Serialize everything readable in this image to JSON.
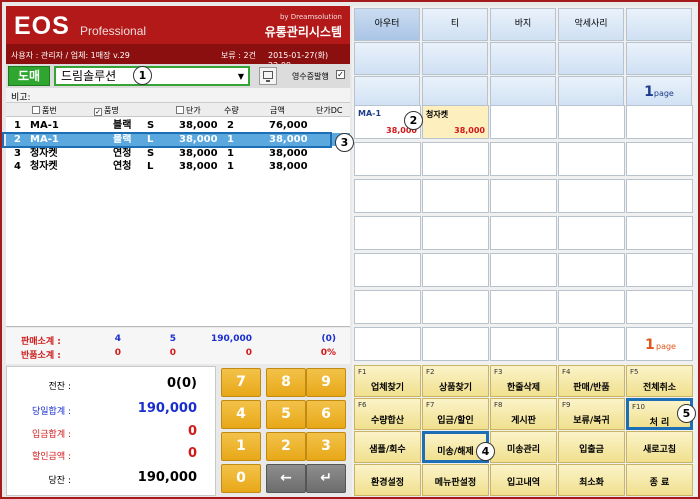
{
  "header": {
    "logo_main": "EOS",
    "logo_sub": "Professional",
    "by": "by Dreamsolution",
    "system_title": "유통관리시스템",
    "user_info": "사용자 : 관리자 / 업체: 1매장 v.29",
    "hold_label": "보류 :",
    "hold_count": "2건",
    "date": "2015-01-27(화) 22:09"
  },
  "customer": {
    "type_button": "도매",
    "selected": "드림솔루션",
    "receipt_label": "영수증발행",
    "receipt_checked": "✓",
    "note_label": "비고:"
  },
  "table": {
    "headers": [
      "품번",
      "품명",
      "단가",
      "수량",
      "금액",
      "단가DC"
    ],
    "header_checks": [
      "",
      "✓",
      ""
    ],
    "rows": [
      {
        "no": "1",
        "code": "MA-1",
        "color": "블랙",
        "size": "S",
        "price": "38,000",
        "qty": "2",
        "amount": "76,000"
      },
      {
        "no": "2",
        "code": "MA-1",
        "color": "블랙",
        "size": "L",
        "price": "38,000",
        "qty": "1",
        "amount": "38,000"
      },
      {
        "no": "3",
        "code": "청자켓",
        "color": "연청",
        "size": "S",
        "price": "38,000",
        "qty": "1",
        "amount": "38,000"
      },
      {
        "no": "4",
        "code": "청자켓",
        "color": "연청",
        "size": "L",
        "price": "38,000",
        "qty": "1",
        "amount": "38,000"
      }
    ]
  },
  "summary": {
    "sales": {
      "label": "판매소계 :",
      "a": "4",
      "b": "5",
      "amount": "190,000",
      "pct": "(0)"
    },
    "returns": {
      "label": "반품소계 :",
      "a": "0",
      "b": "0",
      "amount": "0",
      "pct": "0%"
    }
  },
  "totals": [
    {
      "label": "전잔 :",
      "value": "0(0)",
      "color": "#000000"
    },
    {
      "label": "당일합계 :",
      "value": "190,000",
      "color": "#1a2ed0"
    },
    {
      "label": "입금합계 :",
      "value": "0",
      "color": "#d01a1a"
    },
    {
      "label": "할인금액 :",
      "value": "0",
      "color": "#d01a1a"
    },
    {
      "label": "당잔 :",
      "value": "190,000",
      "color": "#000000"
    }
  ],
  "keypad": [
    "7",
    "8",
    "9",
    "4",
    "5",
    "6",
    "1",
    "2",
    "3",
    "0",
    "←",
    "↵"
  ],
  "categories": [
    "아우터",
    "티",
    "바지",
    "악세사리"
  ],
  "page_top": {
    "number": "1",
    "unit": "page"
  },
  "page_bottom": {
    "number": "1",
    "unit": "page"
  },
  "products": [
    {
      "name": "MA-1",
      "price": "38,000"
    },
    {
      "name": "청자켓",
      "price": "38,000"
    }
  ],
  "functions": [
    {
      "key": "F1",
      "label": "업체찾기"
    },
    {
      "key": "F2",
      "label": "상품찾기"
    },
    {
      "key": "F3",
      "label": "한줄삭제"
    },
    {
      "key": "F4",
      "label": "판매/반품"
    },
    {
      "key": "F5",
      "label": "전체취소"
    },
    {
      "key": "F6",
      "label": "수량합산"
    },
    {
      "key": "F7",
      "label": "입금/할인"
    },
    {
      "key": "F8",
      "label": "게시판"
    },
    {
      "key": "F9",
      "label": "보류/복귀"
    },
    {
      "key": "F10",
      "label": "처    리"
    },
    {
      "key": "",
      "label": "샘플/회수"
    },
    {
      "key": "",
      "label": "미송/해제"
    },
    {
      "key": "",
      "label": "미송관리"
    },
    {
      "key": "",
      "label": "입출금"
    },
    {
      "key": "",
      "label": "새로고침"
    },
    {
      "key": "",
      "label": "환경설정"
    },
    {
      "key": "",
      "label": "메뉴판설정"
    },
    {
      "key": "",
      "label": "입고내역"
    },
    {
      "key": "",
      "label": "최소화"
    },
    {
      "key": "",
      "label": "종    료"
    }
  ],
  "callouts": [
    "1",
    "2",
    "3",
    "4",
    "5"
  ],
  "colors": {
    "brand": "#b31919",
    "selection": "#5aa8de",
    "highlight": "#1c6fb4",
    "positive": "#1a2ed0",
    "negative": "#d01a1a"
  }
}
